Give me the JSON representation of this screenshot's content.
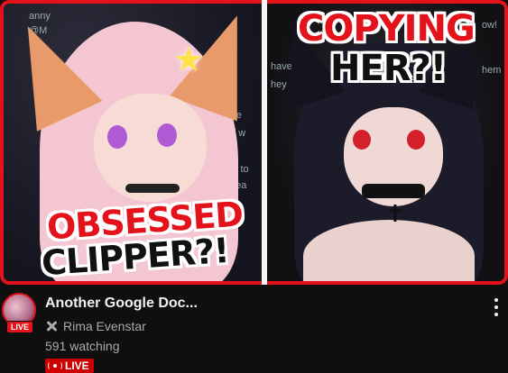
{
  "video": {
    "title": "Another Google Doc...",
    "channel": "Rima Evenstar",
    "watching": "591 watching",
    "badge_label": "LIVE",
    "avatar_live_label": "LIVE"
  },
  "thumbnail": {
    "left_caption_line1": "OBSESSED",
    "left_caption_line2": "CLIPPER?!",
    "right_caption_line1": "COPYING",
    "right_caption_line2": "HER?!",
    "bg_text_1": "anny",
    "bg_text_2": "@M",
    "bg_text_3": "Ple",
    "bg_text_4": "of w",
    "bg_text_5": "cree to",
    "bg_text_6": "mea",
    "bg_text_7": "have",
    "bg_text_8": "hey",
    "bg_text_9": "ow!",
    "bg_text_10": "hem"
  },
  "icons": {
    "channel_verified": "x-icon",
    "live_badge": "broadcast-icon",
    "menu": "more-vert-icon"
  },
  "colors": {
    "accent_red": "#e3121b",
    "live_badge_bg": "#cc0000",
    "background": "#0f0f0f",
    "secondary_text": "#aaaaaa"
  }
}
